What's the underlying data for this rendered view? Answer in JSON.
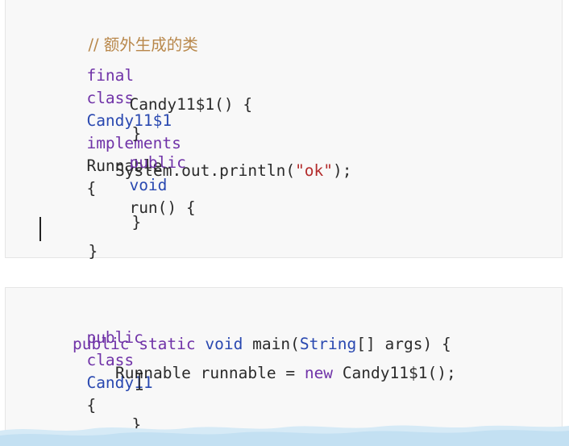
{
  "block1": {
    "comment": "// 额外生成的类",
    "line1": {
      "final": "final",
      "class": "class",
      "name": "Candy11$1",
      "implements": "implements",
      "iface": "Runnable",
      "brace": "{"
    },
    "line2": "Candy11$1() {",
    "line3": "}",
    "line4": {
      "public": "public",
      "void": "void",
      "rest": "run() {"
    },
    "line5": {
      "pre": "System.out.println(",
      "str": "\"ok\"",
      "post": ");"
    },
    "line6": "}",
    "line7": "}"
  },
  "block2": {
    "line1": {
      "public": "public",
      "class": "class",
      "name": "Candy11",
      "brace": "{"
    },
    "line2": {
      "public": "public",
      "static": "static",
      "void": "void",
      "main": "main(",
      "String": "String",
      "rest": "[] args) {"
    },
    "line3": {
      "type": "Runnable",
      "var": "runnable =",
      "new": "new",
      "cls": "Candy11$1",
      "rest": "();"
    },
    "line4": "}",
    "line5": "}"
  },
  "colors": {
    "keyword": "#7033a8",
    "type": "#2948b0",
    "string": "#b32c2c",
    "comment": "#b8874a",
    "background": "#f8f8f8"
  }
}
